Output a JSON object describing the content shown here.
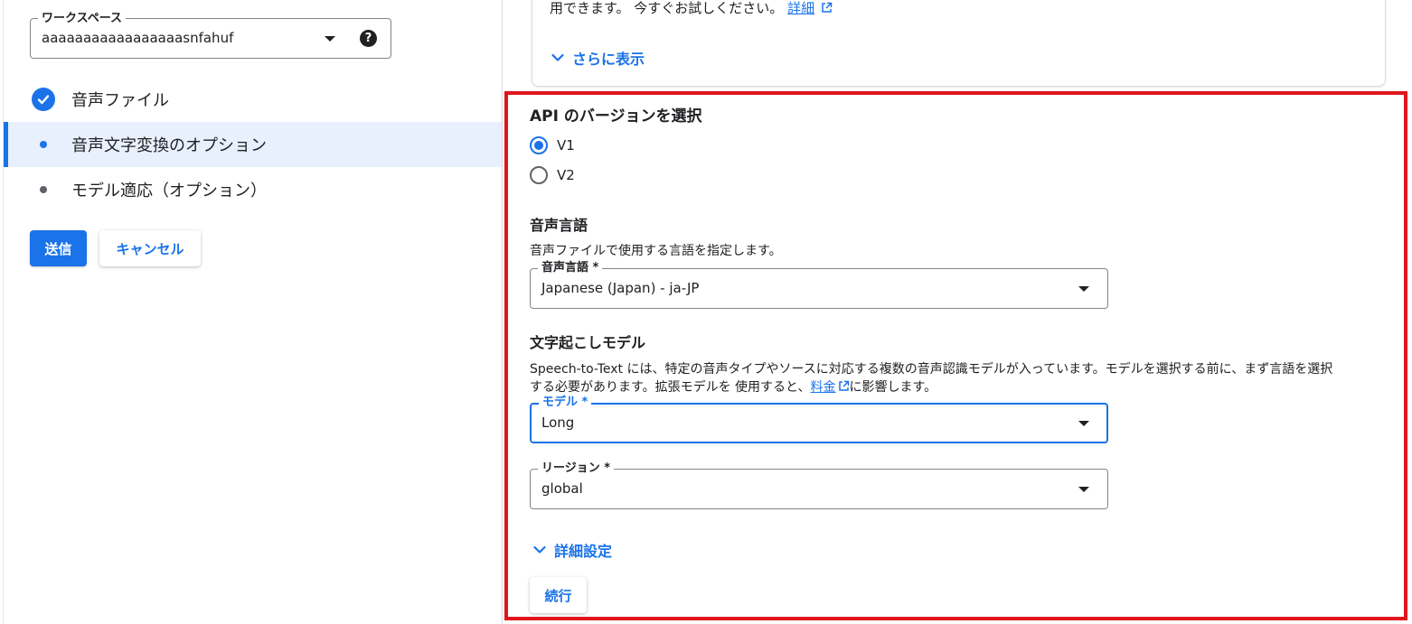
{
  "workspace": {
    "label": "ワークスペース",
    "value": "aaaaaaaaaaaaaaaaasnfahuf",
    "help_glyph": "?"
  },
  "steps": [
    {
      "label": "音声ファイル",
      "state": "done"
    },
    {
      "label": "音声文字変換のオプション",
      "state": "active"
    },
    {
      "label": "モデル適応（オプション）",
      "state": "pending"
    }
  ],
  "actions": {
    "submit_label": "送信",
    "cancel_label": "キャンセル"
  },
  "intro_card": {
    "text": "用できます。 今すぐお試しください。",
    "details_link": "詳細",
    "more_label": "さらに表示"
  },
  "api_version": {
    "title": "API のバージョンを選択",
    "options": [
      {
        "label": "V1",
        "selected": true
      },
      {
        "label": "V2",
        "selected": false
      }
    ]
  },
  "language": {
    "title": "音声言語",
    "description": "音声ファイルで使用する言語を指定します。",
    "field_label": "音声言語 *",
    "value": "Japanese (Japan) - ja-JP"
  },
  "transcription_model": {
    "title": "文字起こしモデル",
    "description_line1": "Speech-to-Text には、特定の音声タイプやソースに対応する複数の音声認識モデルが入っています。モデルを選択する前に、まず言語を選択",
    "description_line2_prefix": "する必要があります。拡張モデルを 使用すると、",
    "pricing_link": "料金",
    "description_line2_suffix": "に影響します。",
    "field_label": "モデル *",
    "value": "Long"
  },
  "region": {
    "field_label": "リージョン *",
    "value": "global"
  },
  "advanced": {
    "label": "詳細設定"
  },
  "continue_label": "続行",
  "colors": {
    "accent": "#1a73e8",
    "highlight_border": "#e0161d",
    "active_step_bg": "#e8f0fe"
  }
}
